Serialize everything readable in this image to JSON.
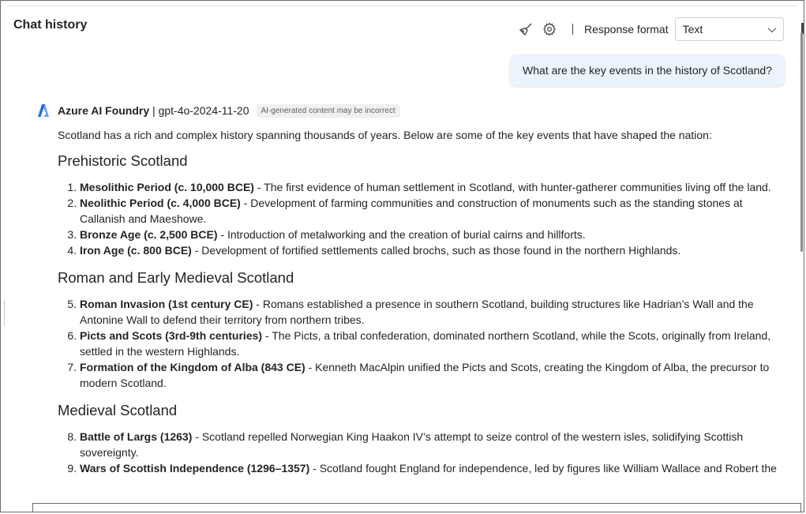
{
  "header": {
    "title": "Chat history",
    "clear_icon": "broom-icon",
    "settings_icon": "gear-icon",
    "separator": "|",
    "response_format_label": "Response format",
    "response_format_value": "Text"
  },
  "user_message": {
    "text": "What are the key events in the history of Scotland?"
  },
  "assistant": {
    "name": "Azure AI Foundry",
    "model": " | gpt-4o-2024-11-20",
    "badge": "AI-generated content may be incorrect",
    "intro": "Scotland has a rich and complex history spanning thousands of years. Below are some of the key events that have shaped the nation:",
    "sections": [
      {
        "heading": "Prehistoric Scotland",
        "items": [
          {
            "title": "Mesolithic Period (c. 10,000 BCE)",
            "text": " - The first evidence of human settlement in Scotland, with hunter-gatherer communities living off the land."
          },
          {
            "title": "Neolithic Period (c. 4,000 BCE)",
            "text": " - Development of farming communities and construction of monuments such as the standing stones at Callanish and Maeshowe."
          },
          {
            "title": "Bronze Age (c. 2,500 BCE)",
            "text": " - Introduction of metalworking and the creation of burial cairns and hillforts."
          },
          {
            "title": "Iron Age (c. 800 BCE)",
            "text": " - Development of fortified settlements called brochs, such as those found in the northern Highlands."
          }
        ]
      },
      {
        "heading": "Roman and Early Medieval Scotland",
        "items": [
          {
            "title": "Roman Invasion (1st century CE)",
            "text": " - Romans established a presence in southern Scotland, building structures like Hadrian’s Wall and the Antonine Wall to defend their territory from northern tribes."
          },
          {
            "title": "Picts and Scots (3rd-9th centuries)",
            "text": " - The Picts, a tribal confederation, dominated northern Scotland, while the Scots, originally from Ireland, settled in the western Highlands."
          },
          {
            "title": "Formation of the Kingdom of Alba (843 CE)",
            "text": " - Kenneth MacAlpin unified the Picts and Scots, creating the Kingdom of Alba, the precursor to modern Scotland."
          }
        ]
      },
      {
        "heading": "Medieval Scotland",
        "items": [
          {
            "title": "Battle of Largs (1263)",
            "text": " - Scotland repelled Norwegian King Haakon IV’s attempt to seize control of the western isles, solidifying Scottish sovereignty."
          },
          {
            "title": "Wars of Scottish Independence (1296–1357)",
            "text": " - Scotland fought England for independence, led by figures like William Wallace and Robert the"
          }
        ]
      }
    ]
  },
  "colors": {
    "user_bubble": "#ebf3fc",
    "badge_bg": "#f0f0f0",
    "logo_blue": "#1f6fe5"
  }
}
